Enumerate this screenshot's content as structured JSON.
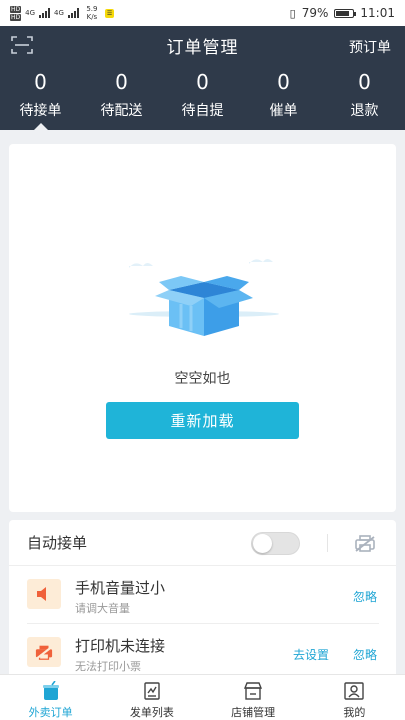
{
  "status_bar": {
    "sim_tags": [
      "HD",
      "HD"
    ],
    "network_tags": [
      "4G",
      "4G"
    ],
    "speed": "5.9 K/s",
    "battery_percent": "79%",
    "time": "11:01",
    "battery_level": 0.79
  },
  "header": {
    "title": "订单管理",
    "right_action": "预订单",
    "scan_icon": "scan-icon",
    "background": "#2f3a4a",
    "stats": [
      {
        "count": "0",
        "label": "待接单"
      },
      {
        "count": "0",
        "label": "待配送"
      },
      {
        "count": "0",
        "label": "待自提"
      },
      {
        "count": "0",
        "label": "催单"
      },
      {
        "count": "0",
        "label": "退款"
      }
    ]
  },
  "empty_state": {
    "icon": "empty-box-icon",
    "text": "空空如也",
    "reload_label": "重新加载"
  },
  "settings": {
    "auto_accept_label": "自动接单",
    "auto_accept_on": false,
    "printer_status_icon": "printer-off-icon",
    "alerts": [
      {
        "icon": "speaker-icon",
        "title": "手机音量过小",
        "subtitle": "请调大音量",
        "actions": [
          "忽略"
        ]
      },
      {
        "icon": "printer-off-icon",
        "title": "打印机未连接",
        "subtitle": "无法打印小票",
        "actions": [
          "去设置",
          "忽略"
        ]
      }
    ]
  },
  "bottom_nav": [
    {
      "label": "外卖订单",
      "icon": "takeaway-cup-icon",
      "active": true
    },
    {
      "label": "发单列表",
      "icon": "dispatch-list-icon",
      "active": false
    },
    {
      "label": "店铺管理",
      "icon": "shop-icon",
      "active": false
    },
    {
      "label": "我的",
      "icon": "profile-icon",
      "active": false
    }
  ],
  "colors": {
    "accent": "#1fb4d8",
    "link": "#1fa5d4",
    "alert_bg": "#fdecd7",
    "alert_icon": "#f0613a"
  }
}
